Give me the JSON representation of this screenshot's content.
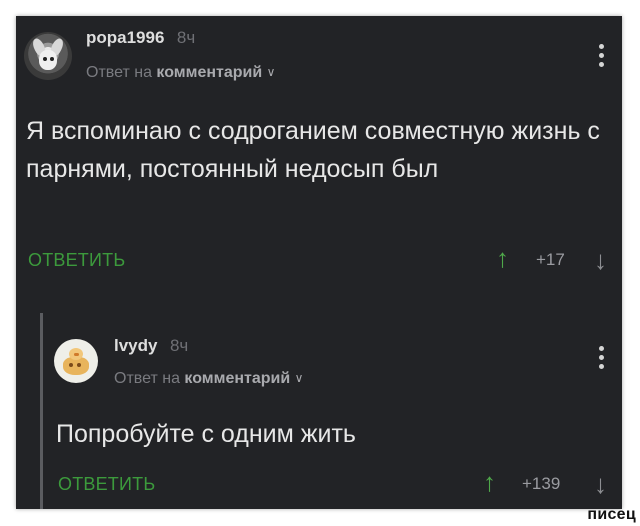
{
  "comment1": {
    "username": "popa1996",
    "time": "8ч",
    "reply_prefix": "Ответ на",
    "reply_target": "комментарий",
    "text": "Я вспоминаю с содроганием совместную жизнь с парнями, постоянный недосып был",
    "reply_button": "ОТВЕТИТЬ",
    "score": "+17"
  },
  "comment2": {
    "username": "lvydy",
    "time": "8ч",
    "reply_prefix": "Ответ на",
    "reply_target": "комментарий",
    "text": "Попробуйте с одним жить",
    "reply_button": "ОТВЕТИТЬ",
    "score": "+139"
  },
  "icons": {
    "up": "↑",
    "down": "↓",
    "chevron": "∨"
  },
  "watermark": "писец"
}
